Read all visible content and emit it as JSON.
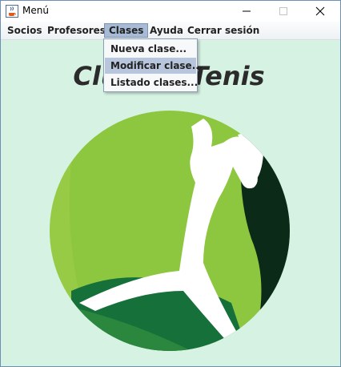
{
  "window": {
    "title": "Menú",
    "icon": "java-coffee-icon"
  },
  "title_controls": {
    "minimize": "minimize-icon",
    "maximize": "maximize-icon",
    "close": "close-icon"
  },
  "menubar": {
    "items": [
      {
        "label": "Socios"
      },
      {
        "label": "Profesores"
      },
      {
        "label": "Clases"
      },
      {
        "label": "Ayuda"
      },
      {
        "label": "Cerrar sesión"
      }
    ],
    "active": "Clases"
  },
  "dropdown": {
    "items": [
      {
        "label": "Nueva clase..."
      },
      {
        "label": "Modificar clase..."
      },
      {
        "label": "Listado clases..."
      }
    ],
    "highlighted": "Modificar clase..."
  },
  "main": {
    "heading": "Club de Tenis",
    "logo": "tennis-player-logo"
  },
  "colors": {
    "background": "#d6f2e3",
    "menu_active": "#a7bbd6",
    "logo_light_green": "#8dc63f",
    "logo_dark_green": "#0c2a18",
    "logo_mid_green": "#15703a"
  }
}
